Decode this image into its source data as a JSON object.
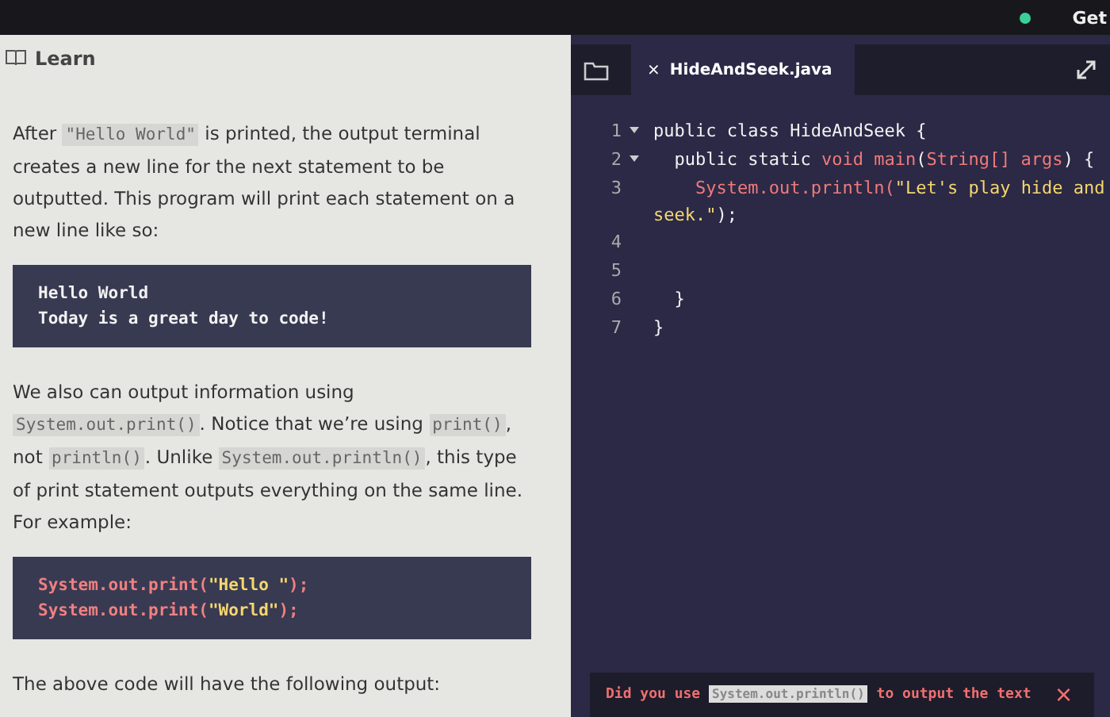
{
  "top_bar": {
    "link": "Get"
  },
  "learn": {
    "title": "Learn",
    "blocks": [
      {
        "kind": "paragraph",
        "parts": [
          {
            "text": "After ",
            "code": false
          },
          {
            "text": "\"Hello World\"",
            "code": true
          },
          {
            "text": " is printed, the output terminal creates a new line for the next statement to be outputted. This program will print each statement on a new line like so:",
            "code": false
          }
        ]
      },
      {
        "kind": "output",
        "lines": [
          "Hello World",
          "Today is a great day to code!"
        ]
      },
      {
        "kind": "paragraph",
        "parts": [
          {
            "text": "We also can output information using ",
            "code": false
          },
          {
            "text": "System.out.print()",
            "code": true
          },
          {
            "text": ". Notice that we’re using ",
            "code": false
          },
          {
            "text": "print()",
            "code": true
          },
          {
            "text": ", not ",
            "code": false
          },
          {
            "text": "println()",
            "code": true
          },
          {
            "text": ". Unlike ",
            "code": false
          },
          {
            "text": "System.out.println()",
            "code": true
          },
          {
            "text": ", this type of print statement outputs everything on the same line. For example:",
            "code": false
          }
        ]
      },
      {
        "kind": "code",
        "lines": [
          [
            {
              "t": "System.out.print(",
              "kind": "plain"
            },
            {
              "t": "\"Hello \"",
              "kind": "string"
            },
            {
              "t": ");",
              "kind": "plain"
            }
          ],
          [
            {
              "t": "System.out.print(",
              "kind": "plain"
            },
            {
              "t": "\"World\"",
              "kind": "string"
            },
            {
              "t": ");",
              "kind": "plain"
            }
          ]
        ]
      },
      {
        "kind": "paragraph",
        "parts": [
          {
            "text": "The above code will have the following output:",
            "code": false
          }
        ]
      }
    ]
  },
  "editor": {
    "tab": {
      "close": "×",
      "label": "HideAndSeek.java",
      "selected": true
    },
    "lines": [
      {
        "number": "1",
        "foldable": true,
        "tokens": [
          {
            "t": "public class HideAndSeek {",
            "kind": "plain"
          }
        ]
      },
      {
        "number": "2",
        "foldable": true,
        "tokens": [
          {
            "t": "  public static ",
            "kind": "plain"
          },
          {
            "t": "void main",
            "kind": "keyword"
          },
          {
            "t": "(",
            "kind": "plain"
          },
          {
            "t": "String[]",
            "kind": "type"
          },
          {
            "t": " args",
            "kind": "keyword"
          },
          {
            "t": ") {",
            "kind": "plain"
          }
        ]
      },
      {
        "number": "3",
        "foldable": false,
        "tokens": [
          {
            "t": "    System.out.println(",
            "kind": "keyword"
          },
          {
            "t": "\"Let's play hide and seek.\"",
            "kind": "string"
          },
          {
            "t": ");",
            "kind": "plain"
          }
        ]
      },
      {
        "number": "4",
        "foldable": false
      },
      {
        "number": "5",
        "foldable": false
      },
      {
        "number": "6",
        "foldable": false,
        "tokens": [
          {
            "t": "  }",
            "kind": "plain"
          }
        ]
      },
      {
        "number": "7",
        "foldable": false,
        "tokens": [
          {
            "t": "}",
            "kind": "plain"
          }
        ]
      }
    ],
    "error": {
      "parts": [
        {
          "text": "Did you use ",
          "code": false
        },
        {
          "text": "System.out.println()",
          "code": true
        },
        {
          "text": " to output the text",
          "code": false
        }
      ],
      "close": "×"
    }
  }
}
